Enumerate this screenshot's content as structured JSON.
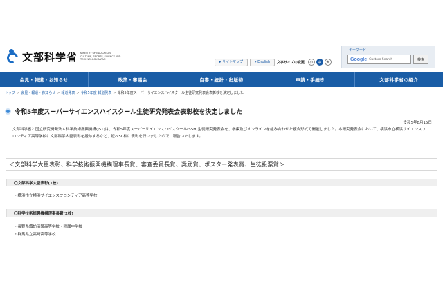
{
  "header": {
    "logo_text": "文部科学省",
    "logo_sub": "MINISTRY OF EDUCATION, CULTURE, SPORTS, SCIENCE AND TECHNOLOGY-JAPAN",
    "sitemap_label": "サイトマップ",
    "english_label": "English",
    "font_size_label": "文字サイズの変更",
    "font_sizes": [
      "小",
      "中",
      "大"
    ],
    "keyword_label": "キーワード",
    "search_brand": "Google",
    "search_placeholder": "Custom Search",
    "search_button": "検索"
  },
  "nav": {
    "items": [
      "会見・報道・お知らせ",
      "政策・審議会",
      "白書・統計・出版物",
      "申請・手続き",
      "文部科学省の紹介"
    ]
  },
  "breadcrumb": {
    "items": [
      "トップ",
      "会見・報道・お知らせ",
      "報道発表",
      "令和5年度 報道発表"
    ],
    "current": "令和5年度スーパーサイエンスハイスクール生徒研究発表会表彰校を決定しました"
  },
  "article": {
    "title": "令和5年度スーパーサイエンスハイスクール生徒研究発表会表彰校を決定しました",
    "date": "令和5年8月15日",
    "intro": "文部科学省と国立研究開発法人科学技術振興機構(JST)は、令和5年度スーパーサイエンスハイスクール(SSH)生徒研究発表会を、参集及びオンラインを組み合わせた複合形式で開催しました。本研究発表会において、横浜市立横浜サイエンスフロンティア高等学校に文部科学大臣表彰を授与するなど、延べ50校に表彰を行いましたので、報告いたします。",
    "banner": "＜文部科学大臣表彰、科学技術振興機構理事長賞、審査委員長賞、奨励賞、ポスター発表賞、生徒投票賞＞",
    "sections": [
      {
        "heading": "〇文部科学大臣表彰(1校)",
        "items": [
          "・横浜市立横浜サイエンスフロンティア高等学校"
        ]
      },
      {
        "heading": "〇科学技術振興機構理事長賞(2校)",
        "items": [
          "・長野県諏訪清陵高等学校・附属中学校",
          "・群馬県立高崎高等学校"
        ]
      }
    ]
  },
  "colors": {
    "nav_bg": "#1a5da6",
    "link": "#1a5ca8",
    "section_bg": "#efefef"
  }
}
